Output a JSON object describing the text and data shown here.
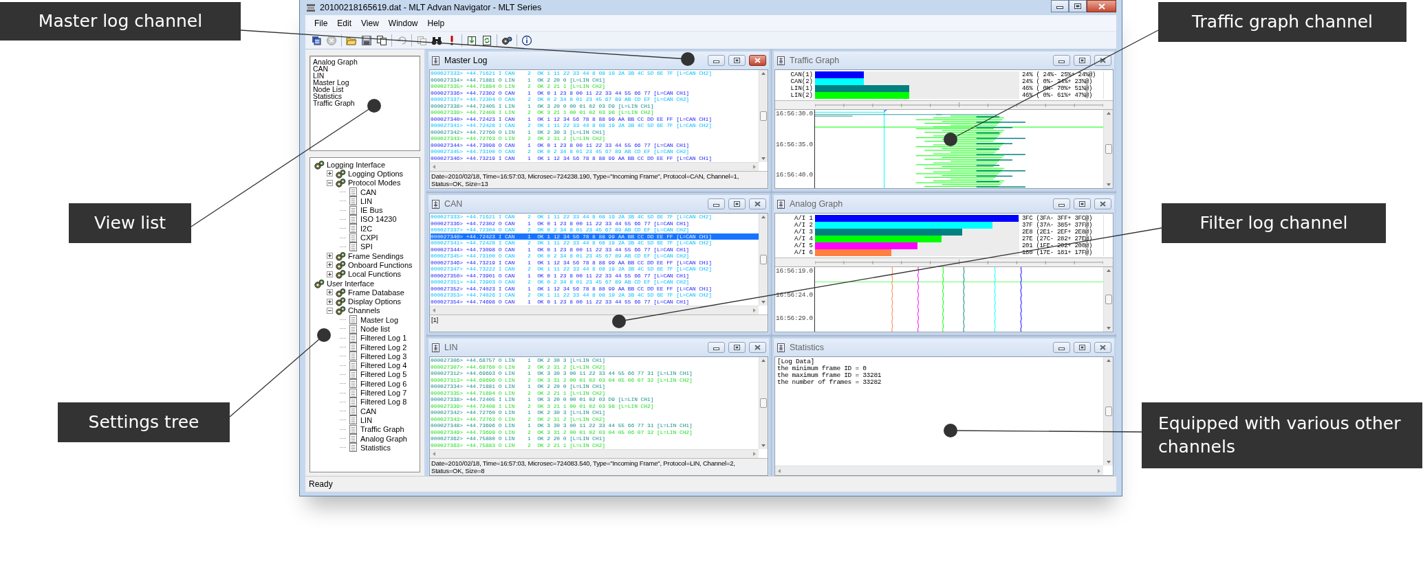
{
  "window": {
    "title": "20100218165619.dat - MLT Advan Navigator - MLT Series"
  },
  "menu": [
    "File",
    "Edit",
    "View",
    "Window",
    "Help"
  ],
  "view_list": [
    "Analog Graph",
    "CAN",
    "LIN",
    "Master Log",
    "Node List",
    "Statistics",
    "Traffic Graph"
  ],
  "settings_tree": [
    {
      "label": "Logging Interface",
      "kind": "group",
      "children": [
        {
          "label": "Logging Options",
          "kind": "group",
          "expanded": false
        },
        {
          "label": "Protocol Modes",
          "kind": "group",
          "expanded": true,
          "children": [
            {
              "label": "CAN",
              "kind": "item"
            },
            {
              "label": "LIN",
              "kind": "item"
            },
            {
              "label": "IE Bus",
              "kind": "item"
            },
            {
              "label": "ISO 14230",
              "kind": "item"
            },
            {
              "label": "I2C",
              "kind": "item"
            },
            {
              "label": "CXPI",
              "kind": "item"
            },
            {
              "label": "SPI",
              "kind": "item"
            }
          ]
        },
        {
          "label": "Frame Sendings",
          "kind": "group",
          "expanded": false
        },
        {
          "label": "Onboard Functions",
          "kind": "group",
          "expanded": false
        },
        {
          "label": "Local Functions",
          "kind": "group",
          "expanded": false
        }
      ]
    },
    {
      "label": "User Interface",
      "kind": "group",
      "children": [
        {
          "label": "Frame Database",
          "kind": "group",
          "expanded": false
        },
        {
          "label": "Display Options",
          "kind": "group",
          "expanded": false
        },
        {
          "label": "Channels",
          "kind": "group",
          "expanded": true,
          "children": [
            {
              "label": "Master Log",
              "kind": "item"
            },
            {
              "label": "Node list",
              "kind": "item"
            },
            {
              "label": "Filtered Log 1",
              "kind": "item"
            },
            {
              "label": "Filtered Log 2",
              "kind": "item"
            },
            {
              "label": "Filtered Log 3",
              "kind": "item"
            },
            {
              "label": "Filtered Log 4",
              "kind": "item"
            },
            {
              "label": "Filtered Log 5",
              "kind": "item"
            },
            {
              "label": "Filtered Log 6",
              "kind": "item"
            },
            {
              "label": "Filtered Log 7",
              "kind": "item"
            },
            {
              "label": "Filtered Log 8",
              "kind": "item"
            },
            {
              "label": "CAN",
              "kind": "item"
            },
            {
              "label": "LIN",
              "kind": "item"
            },
            {
              "label": "Traffic Graph",
              "kind": "item"
            },
            {
              "label": "Analog Graph",
              "kind": "item"
            },
            {
              "label": "Statistics",
              "kind": "item"
            }
          ]
        }
      ]
    }
  ],
  "channels": [
    {
      "kind": "log",
      "title": "Master Log",
      "active": true,
      "rows": [
        {
          "text": "000027333> +44.71621 I CAN    2  OK 1 11 22 33 44 8 08 19 2A 3B 4C 5D 6E 7F [L=CAN CH2]",
          "kind": "can2",
          "selected": false
        },
        {
          "text": "000027334> +44.71881 O LIN    1  OK 2 20 0 [L=LIN CH1]",
          "kind": "lin1",
          "selected": false
        },
        {
          "text": "000027335> +44.71884 O LIN    2  OK 2 21 1 [L=LIN CH2]",
          "kind": "lin2",
          "selected": false
        },
        {
          "text": "000027336> +44.72302 O CAN    1  OK 0 1 23 8 00 11 22 33 44 55 66 77 [L=CAN CH1]",
          "kind": "can1",
          "selected": false
        },
        {
          "text": "000027337> +44.72304 O CAN    2  OK 0 2 34 8 01 23 45 67 89 AB CD EF [L=CAN CH2]",
          "kind": "can2",
          "selected": false
        },
        {
          "text": "000027338> +44.72405 I LIN    1  OK 3 20 0 00 01 02 03 D9 [L=LIN CH1]",
          "kind": "lin1",
          "selected": false
        },
        {
          "text": "000027339> +44.72408 I LIN    2  OK 3 21 1 00 01 02 03 98 [L=LIN CH2]",
          "kind": "lin2",
          "selected": false
        },
        {
          "text": "000027340> +44.72423 I CAN    1  OK 1 12 34 56 78 8 88 99 AA BB CC DD EE FF [L=CAN CH1]",
          "kind": "can1",
          "selected": false
        },
        {
          "text": "000027341> +44.72428 I CAN    2  OK 1 11 22 33 44 8 08 19 2A 3B 4C 5D 6E 7F [L=CAN CH2]",
          "kind": "can2",
          "selected": false
        },
        {
          "text": "000027342> +44.72760 O LIN    1  OK 2 30 3 [L=LIN CH1]",
          "kind": "lin1",
          "selected": false
        },
        {
          "text": "000027343> +44.72763 O LIN    2  OK 2 31 2 [L=LIN CH2]",
          "kind": "lin2",
          "selected": false
        },
        {
          "text": "000027344> +44.73098 O CAN    1  OK 0 1 23 8 00 11 22 33 44 55 66 77 [L=CAN CH1]",
          "kind": "can1",
          "selected": false
        },
        {
          "text": "000027345> +44.73100 O CAN    2  OK 0 2 34 8 01 23 45 67 89 AB CD EF [L=CAN CH2]",
          "kind": "can2",
          "selected": false
        },
        {
          "text": "000027346> +44.73219 I CAN    1  OK 1 12 34 56 78 8 88 99 AA BB CC DD EE FF [L=CAN CH1]",
          "kind": "can1",
          "selected": false
        }
      ],
      "detail": [
        "Date=2010/02/18, Time=16:57:03, Microsec=724238.190, Type=\"Incoming Frame\", Protocol=CAN, Channel=1,",
        "Status=OK, Size=13"
      ]
    },
    {
      "kind": "bar_graph",
      "title": "Traffic Graph",
      "active": false,
      "legend": [
        {
          "label": "CAN(1)",
          "color": "#0000ff",
          "level": 0.24,
          "reading": "24% ( 24%- 25%+ 24%@)"
        },
        {
          "label": "CAN(2)",
          "color": "#00ffff",
          "level": 0.24,
          "reading": "24% ( 0%- 24%+ 23%@)"
        },
        {
          "label": "LIN(1)",
          "color": "#008080",
          "level": 0.46,
          "reading": "46% ( 0%- 70%+ 51%@)"
        },
        {
          "label": "LIN(2)",
          "color": "#00ff00",
          "level": 0.46,
          "reading": "46% ( 0%- 61%+ 47%@)"
        }
      ],
      "time_labels": [
        "16:56:30.0",
        "16:56:35.0",
        "16:56:40.0"
      ]
    },
    {
      "kind": "log",
      "title": "CAN",
      "active": false,
      "rows": [
        {
          "text": "000027333> +44.71621 I CAN    2  OK 1 11 22 33 44 8 08 19 2A 3B 4C 5D 6E 7F [L=CAN CH2]",
          "kind": "can2",
          "selected": false
        },
        {
          "text": "000027336> +44.72302 O CAN    1  OK 0 1 23 8 00 11 22 33 44 55 66 77 [L=CAN CH1]",
          "kind": "can1",
          "selected": false
        },
        {
          "text": "000027337> +44.72304 O CAN    2  OK 0 2 34 8 01 23 45 67 89 AB CD EF [L=CAN CH2]",
          "kind": "can2",
          "selected": false
        },
        {
          "text": "000027340> +44.72423 I CAN    1  OK 1 12 34 56 78 8 88 99 AA BB CC DD EE FF [L=CAN CH1]",
          "kind": "can1",
          "selected": true
        },
        {
          "text": "000027341> +44.72428 I CAN    2  OK 1 11 22 33 44 8 08 19 2A 3B 4C 5D 6E 7F [L=CAN CH2]",
          "kind": "can2",
          "selected": false
        },
        {
          "text": "000027344> +44.73098 O CAN    1  OK 0 1 23 8 00 11 22 33 44 55 66 77 [L=CAN CH1]",
          "kind": "can1",
          "selected": false
        },
        {
          "text": "000027345> +44.73100 O CAN    2  OK 0 2 34 8 01 23 45 67 89 AB CD EF [L=CAN CH2]",
          "kind": "can2",
          "selected": false
        },
        {
          "text": "000027346> +44.73219 I CAN    1  OK 1 12 34 56 78 8 88 99 AA BB CC DD EE FF [L=CAN CH1]",
          "kind": "can1",
          "selected": false
        },
        {
          "text": "000027347> +44.73222 I CAN    2  OK 1 11 22 33 44 8 08 19 2A 3B 4C 5D 6E 7F [L=CAN CH2]",
          "kind": "can2",
          "selected": false
        },
        {
          "text": "000027350> +44.73901 O CAN    1  OK 0 1 23 8 00 11 22 33 44 55 66 77 [L=CAN CH1]",
          "kind": "can1",
          "selected": false
        },
        {
          "text": "000027351> +44.73903 O CAN    2  OK 0 2 34 8 01 23 45 67 89 AB CD EF [L=CAN CH2]",
          "kind": "can2",
          "selected": false
        },
        {
          "text": "000027352> +44.74023 I CAN    1  OK 1 12 34 56 78 8 88 99 AA BB CC DD EE FF [L=CAN CH1]",
          "kind": "can1",
          "selected": false
        },
        {
          "text": "000027353> +44.74026 I CAN    2  OK 1 11 22 33 44 8 08 19 2A 3B 4C 5D 6E 7F [L=CAN CH2]",
          "kind": "can2",
          "selected": false
        },
        {
          "text": "000027354> +44.74698 O CAN    1  OK 0 1 23 8 00 11 22 33 44 55 66 77 [L=CAN CH1]",
          "kind": "can1",
          "selected": false
        }
      ],
      "detail": [
        "[1]"
      ]
    },
    {
      "kind": "bar_graph",
      "title": "Analog Graph",
      "active": false,
      "legend": [
        {
          "label": "A/I 1",
          "color": "#0000ff",
          "level": 0.996,
          "reading": "3FC (3FA- 3FF+ 3FC@)"
        },
        {
          "label": "A/I 2",
          "color": "#00ffff",
          "level": 0.87,
          "reading": "37F (37A- 385+ 37F@)"
        },
        {
          "label": "A/I 3",
          "color": "#008080",
          "level": 0.72,
          "reading": "2E8 (2E1- 2EF+ 2E8@)"
        },
        {
          "label": "A/I 4",
          "color": "#00ff00",
          "level": 0.62,
          "reading": "27E (27C- 282+ 27E@)"
        },
        {
          "label": "A/I 5",
          "color": "#ff00ff",
          "level": 0.5,
          "reading": "201 (1FE- 202+ 200@)"
        },
        {
          "label": "A/I 6",
          "color": "#ff7f40",
          "level": 0.375,
          "reading": "180 (17E- 181+ 17F@)"
        }
      ],
      "time_labels": [
        "16:56:19.0",
        "16:56:24.0",
        "16:56:29.0"
      ]
    },
    {
      "kind": "log",
      "title": "LIN",
      "active": false,
      "rows": [
        {
          "text": "000027306> +44.68757 O LIN    1  OK 2 30 3 [L=LIN CH1]",
          "kind": "lin1",
          "selected": false
        },
        {
          "text": "000027307> +44.68760 O LIN    2  OK 2 31 2 [L=LIN CH2]",
          "kind": "lin2",
          "selected": false
        },
        {
          "text": "000027312> +44.69693 O LIN    1  OK 3 30 3 00 11 22 33 44 55 66 77 31 [L=LIN CH1]",
          "kind": "lin1",
          "selected": false
        },
        {
          "text": "000027313> +44.69696 O LIN    2  OK 3 31 2 00 01 02 03 04 05 06 07 32 [L=LIN CH2]",
          "kind": "lin2",
          "selected": false
        },
        {
          "text": "000027334> +44.71881 O LIN    1  OK 2 20 0 [L=LIN CH1]",
          "kind": "lin1",
          "selected": false
        },
        {
          "text": "000027335> +44.71884 O LIN    2  OK 2 21 1 [L=LIN CH2]",
          "kind": "lin2",
          "selected": false
        },
        {
          "text": "000027338> +44.72405 I LIN    1  OK 3 20 0 00 01 02 03 D9 [L=LIN CH1]",
          "kind": "lin1",
          "selected": false
        },
        {
          "text": "000027339> +44.72408 I LIN    2  OK 3 21 1 00 01 02 03 98 [L=LIN CH2]",
          "kind": "lin2",
          "selected": false
        },
        {
          "text": "000027342> +44.72760 O LIN    1  OK 2 30 3 [L=LIN CH1]",
          "kind": "lin1",
          "selected": false
        },
        {
          "text": "000027343> +44.72763 O LIN    2  OK 2 31 2 [L=LIN CH2]",
          "kind": "lin2",
          "selected": false
        },
        {
          "text": "000027348> +44.73696 O LIN    1  OK 3 30 3 00 11 22 33 44 55 66 77 31 [L=LIN CH1]",
          "kind": "lin1",
          "selected": false
        },
        {
          "text": "000027349> +44.73699 O LIN    2  OK 3 31 2 00 01 02 03 04 05 06 07 32 [L=LIN CH2]",
          "kind": "lin2",
          "selected": false
        },
        {
          "text": "000027362> +44.75880 O LIN    1  OK 2 20 0 [L=LIN CH1]",
          "kind": "lin1",
          "selected": false
        },
        {
          "text": "000027363> +44.75883 O LIN    2  OK 2 21 1 [L=LIN CH2]",
          "kind": "lin2",
          "selected": false
        }
      ],
      "detail": [
        "Date=2010/02/18, Time=16:57:03, Microsec=724083.540, Type=\"Incoming Frame\", Protocol=LIN, Channel=2,",
        "Status=OK, Size=8"
      ]
    },
    {
      "kind": "text",
      "title": "Statistics",
      "active": false,
      "lines": [
        "[Log Data]",
        "the minimum frame ID = 0",
        "the maximum frame ID = 33281",
        "the number of frames = 33282"
      ]
    }
  ],
  "status_bar": "Ready",
  "callouts": [
    "Master log channel",
    "View list",
    "Settings tree",
    "Traffic graph channel",
    "Filter log channel",
    "Equipped with various other channels"
  ]
}
